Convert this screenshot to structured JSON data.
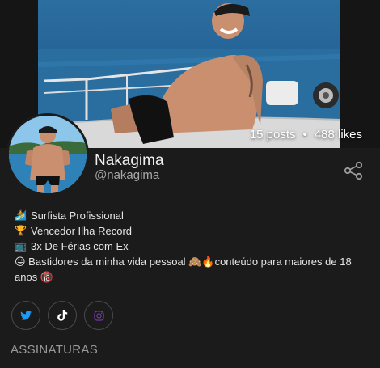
{
  "profile": {
    "name": "Nakagima",
    "handle": "@nakagima",
    "posts": "15 posts",
    "separator": "•",
    "likes": "488 likes"
  },
  "bio": {
    "lines": [
      {
        "icon": "surfer-icon",
        "emoji": "🏄",
        "text": "Surfista Profissional"
      },
      {
        "icon": "trophy-icon",
        "emoji": "🏆",
        "text": "Vencedor Ilha Record"
      },
      {
        "icon": "tv-icon",
        "emoji": "📺",
        "text": "3x De Férias com Ex"
      }
    ],
    "last_line": {
      "emoji_start": "😛",
      "text_a": " Bastidores da minha vida pessoal ",
      "emoji_mid": "🙈🔥",
      "text_b": "conteúdo para maiores de 18 anos ",
      "emoji_end": "🔞"
    }
  },
  "social_links": [
    {
      "name": "twitter",
      "icon": "twitter-icon",
      "color": "#1d9bf0"
    },
    {
      "name": "tiktok",
      "icon": "tiktok-icon",
      "color": "#ffffff"
    },
    {
      "name": "instagram",
      "icon": "instagram-icon",
      "color": "#8a3ab9"
    }
  ],
  "sections": {
    "subscriptions_title": "ASSINATURAS"
  },
  "colors": {
    "background": "#1b1b1c",
    "text_primary": "#f0f0f0",
    "text_secondary": "#a9a9a9"
  }
}
